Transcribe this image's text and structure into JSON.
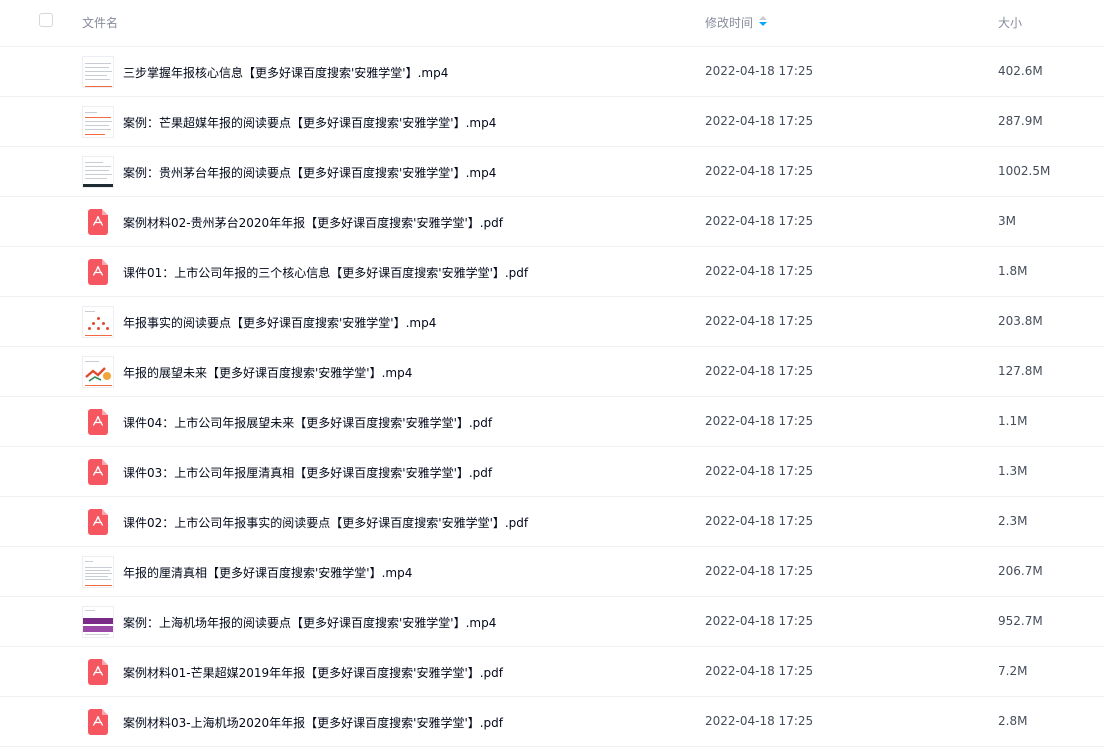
{
  "header": {
    "name_label": "文件名",
    "time_label": "修改时间",
    "size_label": "大小"
  },
  "files": [
    {
      "name": "三步掌握年报核心信息【更多好课百度搜索'安雅学堂'】.mp4",
      "time": "2022-04-18 17:25",
      "size": "402.6M",
      "icon": "video-thumbnail"
    },
    {
      "name": "案例：芒果超媒年报的阅读要点【更多好课百度搜索'安雅学堂'】.mp4",
      "time": "2022-04-18 17:25",
      "size": "287.9M",
      "icon": "video-thumbnail"
    },
    {
      "name": "案例：贵州茅台年报的阅读要点【更多好课百度搜索'安雅学堂'】.mp4",
      "time": "2022-04-18 17:25",
      "size": "1002.5M",
      "icon": "video-thumbnail"
    },
    {
      "name": "案例材料02-贵州茅台2020年年报【更多好课百度搜索'安雅学堂'】.pdf",
      "time": "2022-04-18 17:25",
      "size": "3M",
      "icon": "pdf-icon"
    },
    {
      "name": "课件01：上市公司年报的三个核心信息【更多好课百度搜索'安雅学堂'】.pdf",
      "time": "2022-04-18 17:25",
      "size": "1.8M",
      "icon": "pdf-icon"
    },
    {
      "name": "年报事实的阅读要点【更多好课百度搜索'安雅学堂'】.mp4",
      "time": "2022-04-18 17:25",
      "size": "203.8M",
      "icon": "video-thumbnail"
    },
    {
      "name": "年报的展望未来【更多好课百度搜索'安雅学堂'】.mp4",
      "time": "2022-04-18 17:25",
      "size": "127.8M",
      "icon": "video-thumbnail"
    },
    {
      "name": "课件04：上市公司年报展望未来【更多好课百度搜索'安雅学堂'】.pdf",
      "time": "2022-04-18 17:25",
      "size": "1.1M",
      "icon": "pdf-icon"
    },
    {
      "name": "课件03：上市公司年报厘清真相【更多好课百度搜索'安雅学堂'】.pdf",
      "time": "2022-04-18 17:25",
      "size": "1.3M",
      "icon": "pdf-icon"
    },
    {
      "name": "课件02：上市公司年报事实的阅读要点【更多好课百度搜索'安雅学堂'】.pdf",
      "time": "2022-04-18 17:25",
      "size": "2.3M",
      "icon": "pdf-icon"
    },
    {
      "name": "年报的厘清真相【更多好课百度搜索'安雅学堂'】.mp4",
      "time": "2022-04-18 17:25",
      "size": "206.7M",
      "icon": "video-thumbnail"
    },
    {
      "name": "案例：上海机场年报的阅读要点【更多好课百度搜索'安雅学堂'】.mp4",
      "time": "2022-04-18 17:25",
      "size": "952.7M",
      "icon": "video-thumbnail"
    },
    {
      "name": "案例材料01-芒果超媒2019年年报【更多好课百度搜索'安雅学堂'】.pdf",
      "time": "2022-04-18 17:25",
      "size": "7.2M",
      "icon": "pdf-icon"
    },
    {
      "name": "案例材料03-上海机场2020年年报【更多好课百度搜索'安雅学堂'】.pdf",
      "time": "2022-04-18 17:25",
      "size": "2.8M",
      "icon": "pdf-icon"
    }
  ],
  "colors": {
    "pdf_red": "#f5565f",
    "sort_active": "#06a7ff"
  }
}
